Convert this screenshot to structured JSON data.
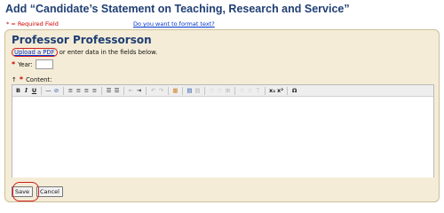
{
  "page": {
    "title": "Add “Candidate’s Statement on Teaching, Research and Service”",
    "required_legend": "* = Required Field",
    "format_link": "Do you want to format text?"
  },
  "form": {
    "professor_name": "Professor Professorson",
    "upload_link": "Upload a PDF",
    "upload_suffix": " or enter data in the fields below.",
    "year_label": "Year:",
    "year_value": "",
    "content_toggle": "↑",
    "content_label": "Content:",
    "required_mark": "*"
  },
  "toolbar": [
    {
      "name": "bold-button",
      "glyph": "B",
      "style": "font-weight:bold"
    },
    {
      "name": "italic-button",
      "glyph": "I",
      "style": "font-style:italic;font-weight:bold;font-family:'DejaVu Serif',serif"
    },
    {
      "name": "underline-button",
      "glyph": "U",
      "style": "text-decoration:underline;font-weight:bold"
    },
    {
      "sep": true
    },
    {
      "name": "horizontal-rule-button",
      "glyph": "—"
    },
    {
      "name": "remove-format-button",
      "glyph": "⊘",
      "cls": "tb-blue"
    },
    {
      "sep": true
    },
    {
      "name": "align-left-button",
      "glyph": "≡"
    },
    {
      "name": "align-center-button",
      "glyph": "≡"
    },
    {
      "name": "align-right-button",
      "glyph": "≡"
    },
    {
      "name": "justify-button",
      "glyph": "≡"
    },
    {
      "sep": true
    },
    {
      "name": "unordered-list-button",
      "glyph": "☰"
    },
    {
      "name": "ordered-list-button",
      "glyph": "☰"
    },
    {
      "sep": true
    },
    {
      "name": "outdent-button",
      "glyph": "⇤",
      "cls": "tb-dis"
    },
    {
      "name": "indent-button",
      "glyph": "⇥"
    },
    {
      "sep": true
    },
    {
      "name": "undo-button",
      "glyph": "↶",
      "cls": "tb-dis"
    },
    {
      "name": "redo-button",
      "glyph": "↷",
      "cls": "tb-dis"
    },
    {
      "sep": true
    },
    {
      "name": "paste-button",
      "glyph": "▦",
      "cls": "tb-orange"
    },
    {
      "sep": true
    },
    {
      "name": "table-button",
      "glyph": "▤",
      "cls": "tb-blue"
    },
    {
      "name": "table-props-button",
      "glyph": "▤",
      "cls": "tb-dis"
    },
    {
      "sep": true
    },
    {
      "name": "insert-row-button",
      "glyph": "∷",
      "cls": "tb-dis"
    },
    {
      "name": "delete-row-button",
      "glyph": "∷",
      "cls": "tb-dis"
    },
    {
      "name": "merge-cells-button",
      "glyph": "⊞",
      "cls": "tb-dis"
    },
    {
      "sep": true
    },
    {
      "name": "insert-col-button",
      "glyph": "∷",
      "cls": "tb-dis"
    },
    {
      "name": "delete-col-button",
      "glyph": "∷",
      "cls": "tb-dis"
    },
    {
      "name": "split-cell-button",
      "glyph": "⊤",
      "cls": "tb-dis"
    },
    {
      "sep": true
    },
    {
      "name": "subscript-button",
      "glyph": "x₂",
      "style": "font-weight:bold"
    },
    {
      "name": "superscript-button",
      "glyph": "x²",
      "style": "font-weight:bold"
    },
    {
      "sep": true
    },
    {
      "name": "special-char-button",
      "glyph": "Ω",
      "style": "font-weight:bold"
    }
  ],
  "actions": {
    "save": "Save",
    "cancel": "Cancel"
  }
}
